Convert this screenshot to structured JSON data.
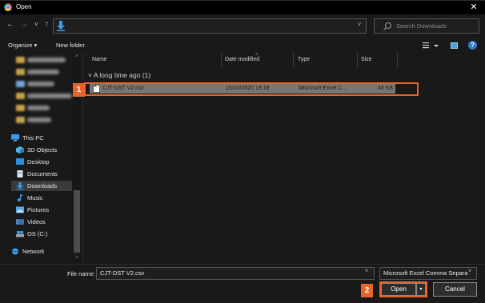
{
  "window": {
    "title": "Open",
    "close_glyph": "✕"
  },
  "nav": {
    "back_glyph": "←",
    "forward_glyph": "→",
    "recent_glyph": "˅",
    "up_glyph": "↑",
    "chevron": "˅",
    "refresh_glyph": "↻"
  },
  "address": {
    "location_icon": "download-arrow-icon"
  },
  "search": {
    "placeholder": "Search Downloads"
  },
  "toolbar": {
    "organize_label": "Organize ▾",
    "new_folder_label": "New folder",
    "help_glyph": "?"
  },
  "sidebar": {
    "this_pc": "This PC",
    "items": [
      {
        "label": "3D Objects",
        "icon": "3d-objects-icon"
      },
      {
        "label": "Desktop",
        "icon": "desktop-icon"
      },
      {
        "label": "Documents",
        "icon": "documents-icon"
      },
      {
        "label": "Downloads",
        "icon": "downloads-icon",
        "selected": true
      },
      {
        "label": "Music",
        "icon": "music-icon"
      },
      {
        "label": "Pictures",
        "icon": "pictures-icon"
      },
      {
        "label": "Videos",
        "icon": "videos-icon"
      },
      {
        "label": "OS (C:)",
        "icon": "drive-icon"
      }
    ],
    "network": "Network",
    "scroll_up": "˄",
    "scroll_down": "˅"
  },
  "columns": {
    "name": "Name",
    "date": "Date modified",
    "type": "Type",
    "size": "Size",
    "sort_caret": "˄"
  },
  "group": {
    "label": "˅ A long time ago (1)"
  },
  "files": [
    {
      "name": "CJT-DST V2.csv",
      "date": "15/10/2020 19:18",
      "type": "Microsoft Excel C...",
      "size": "48 KB"
    }
  ],
  "bottom": {
    "filename_label": "File name:",
    "filename_value": "CJT-DST V2.csv",
    "filetype_value": "Microsoft Excel Comma Separa",
    "open_label": "Open",
    "open_split_glyph": "▾",
    "cancel_label": "Cancel",
    "chevron": "˅"
  },
  "callouts": {
    "step1": "1",
    "step2": "2",
    "color": "#e8642b"
  }
}
